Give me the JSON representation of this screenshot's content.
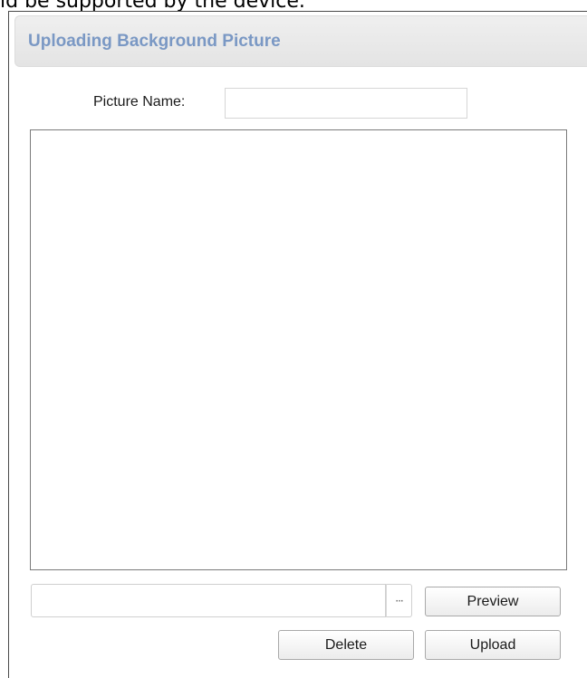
{
  "doc_caption": "ld be supported by the device.",
  "dialog": {
    "title": "Uploading Background Picture",
    "picture_name_label": "Picture Name:",
    "picture_name_value": "",
    "file_path_value": "",
    "browse_label": "···",
    "preview_label": "Preview",
    "delete_label": "Delete",
    "upload_label": "Upload"
  }
}
